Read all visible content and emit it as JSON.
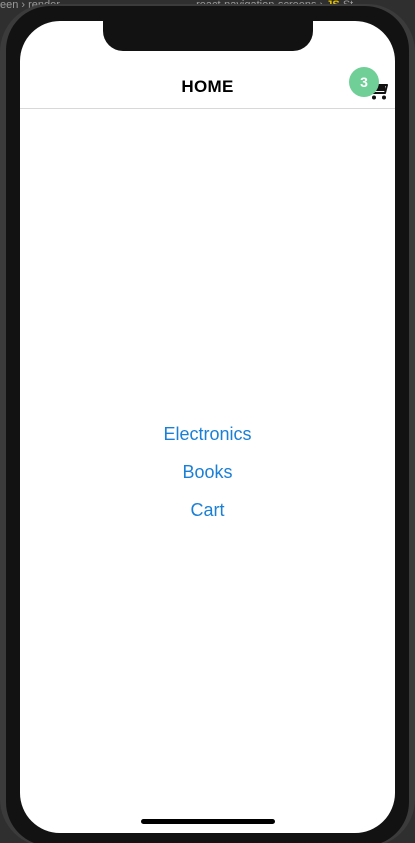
{
  "background_editor": {
    "top_text_left": "een ›",
    "top_text_folder": "render",
    "top_text_mid": "react-navigation-screens ›",
    "top_text_js": "JS",
    "top_text_right": "St"
  },
  "navbar": {
    "title": "HOME",
    "cart_icon": "shopping-cart-icon",
    "cart_count": "3"
  },
  "links": [
    {
      "label": "Electronics"
    },
    {
      "label": "Books"
    },
    {
      "label": "Cart"
    }
  ],
  "colors": {
    "link": "#1a7fd6",
    "badge": "#6fcf97",
    "screen_bg": "#ffffff",
    "frame": "#3b3b3b"
  }
}
